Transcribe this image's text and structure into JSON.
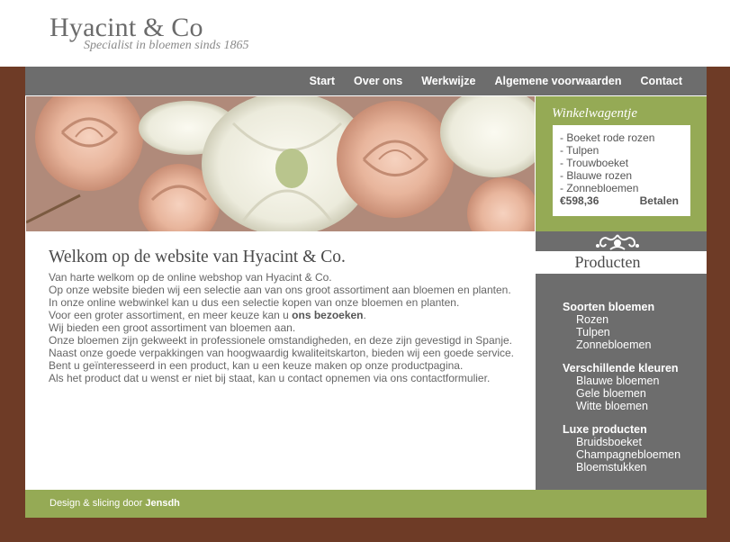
{
  "brand": {
    "name": "Hyacint & Co",
    "tagline": "Specialist in bloemen sinds 1865"
  },
  "nav": {
    "items": [
      "Start",
      "Over ons",
      "Werkwijze",
      "Algemene voorwaarden",
      "Contact"
    ]
  },
  "cart": {
    "title": "Winkelwagentje",
    "items": [
      "- Boeket rode rozen",
      "- Tulpen",
      "- Trouwboeket",
      "- Blauwe rozen",
      "- Zonnebloemen"
    ],
    "total": "€598,36",
    "pay_label": "Betalen"
  },
  "main": {
    "heading": "Welkom op de website van Hyacint & Co.",
    "lines": [
      "Van harte welkom op de online webshop van Hyacint & Co.",
      "Op onze website bieden wij een selectie aan van ons groot assortiment aan bloemen en planten.",
      "In onze online webwinkel kan u dus een selectie kopen van onze bloemen en planten.",
      "Voor een groter assortiment, en meer keuze kan u ",
      "Wij bieden een groot assortiment van bloemen aan.",
      "Onze bloemen zijn gekweekt in professionele omstandigheden, en deze zijn gevestigd in Spanje.",
      "Naast onze goede verpakkingen van hoogwaardig kwaliteitskarton, bieden wij een goede service.",
      "Bent u geïnteresseerd in een product, kan u een keuze maken op onze productpagina.",
      "Als het product dat u wenst er niet bij staat, kan u contact opnemen via ons contactformulier."
    ],
    "visit_link": "ons bezoeken",
    "visit_suffix": "."
  },
  "products": {
    "title": "Producten",
    "categories": [
      {
        "heading": "Soorten bloemen",
        "items": [
          "Rozen",
          "Tulpen",
          "Zonnebloemen"
        ]
      },
      {
        "heading": "Verschillende kleuren",
        "items": [
          "Blauwe bloemen",
          "Gele bloemen",
          "Witte bloemen"
        ]
      },
      {
        "heading": "Luxe producten",
        "items": [
          "Bruidsboeket",
          "Champagnebloemen",
          "Bloemstukken"
        ]
      }
    ]
  },
  "footer": {
    "prefix": "Design & slicing door ",
    "author": "Jensdh"
  },
  "colors": {
    "brown": "#6e3b26",
    "gray": "#6d6d6d",
    "green": "#95aa55"
  }
}
